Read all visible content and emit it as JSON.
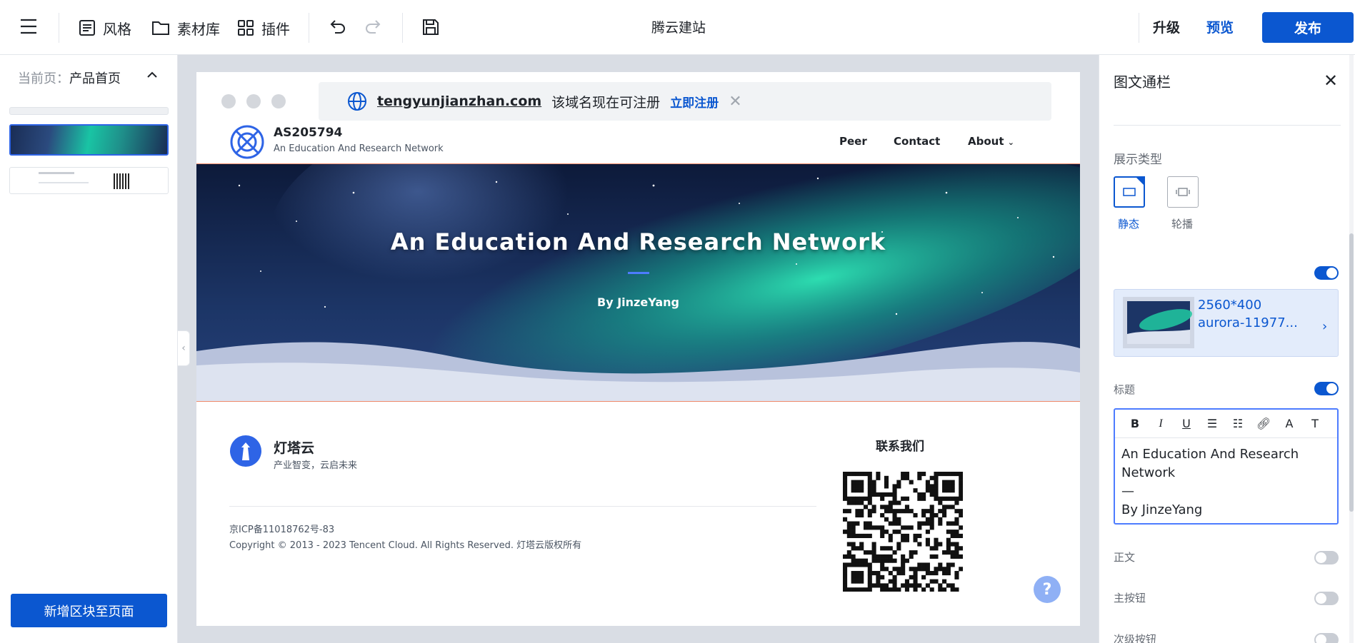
{
  "topbar": {
    "style_label": "风格",
    "assets_label": "素材库",
    "plugins_label": "插件",
    "app_title": "腾云建站",
    "upgrade_label": "升级",
    "preview_label": "预览",
    "publish_label": "发布"
  },
  "left_panel": {
    "current_page_prefix": "当前页：",
    "current_page": "产品首页",
    "add_block_label": "新增区块至页面"
  },
  "site": {
    "domain": {
      "name": "tengyunjianzhan.com",
      "status": "该域名现在可注册",
      "register_label": "立即注册"
    },
    "header": {
      "brand_title": "AS205794",
      "brand_subtitle": "An Education And Research Network",
      "nav": [
        "Peer",
        "Contact",
        "About"
      ]
    },
    "hero": {
      "title": "An Education And Research Network",
      "subtitle": "By JinzeYang"
    },
    "footer": {
      "brand": "灯塔云",
      "slogan": "产业智变，云启未来",
      "icp": "京ICP备11018762号-83",
      "copyright": "Copyright © 2013 - 2023 Tencent Cloud. All Rights Reserved. 灯塔云版权所有",
      "contact_title": "联系我们"
    },
    "help_label": "?"
  },
  "right_panel": {
    "title": "图文通栏",
    "display_type_label": "展示类型",
    "type_static": "静态",
    "type_carousel": "轮播",
    "image_size": "2560*400",
    "image_name": "aurora-11977...",
    "heading_label": "标题",
    "editor_text": "An Education And Research Network\n—\nBy JinzeYang",
    "body_label": "正文",
    "primary_button_label": "主按钮",
    "secondary_button_label": "次级按钮",
    "toggles": {
      "image": true,
      "heading": true,
      "body": false,
      "primary_button": false,
      "secondary_button": false
    }
  },
  "colors": {
    "accent": "#0b57d0",
    "canvas_bg": "#d9dde4"
  }
}
